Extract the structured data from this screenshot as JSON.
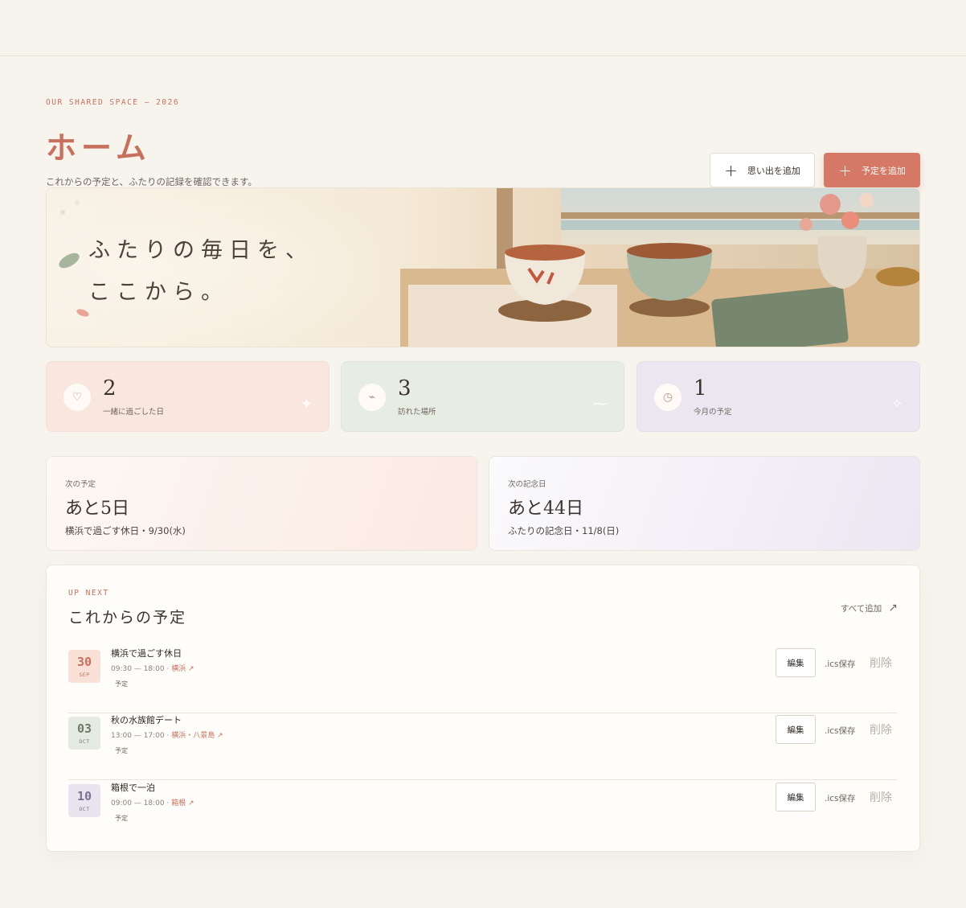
{
  "header": {
    "eyebrow": "OUR SHARED SPACE  —  2026",
    "title": "ホーム",
    "subtitle": "これからの予定と、ふたりの記録を確認できます。"
  },
  "actions": {
    "add_memory": "思い出を追加",
    "add_event": "予定を追加"
  },
  "hero": {
    "line1": "ふたりの毎日を、",
    "line2": "ここから。"
  },
  "stats": [
    {
      "value": "2",
      "label": "一緒に過ごした日",
      "icon": "heart-icon",
      "bg": "#f9e7df"
    },
    {
      "value": "3",
      "label": "訪れた場所",
      "icon": "route-icon",
      "bg": "#e8ede4"
    },
    {
      "value": "1",
      "label": "今月の予定",
      "icon": "clock-icon",
      "bg": "#ebe7f1"
    }
  ],
  "countdowns": [
    {
      "caption": "次の予定",
      "big": "あと5日",
      "info": "横浜で過ごす休日・9/30(水)"
    },
    {
      "caption": "次の記念日",
      "big": "あと44日",
      "info": "ふたりの記念日・11/8(日)"
    }
  ],
  "upcoming": {
    "eyebrow": "UP NEXT",
    "title": "これからの予定",
    "see_all": "すべて追加",
    "edit_label": "編集",
    "ics_label": ".ics保存",
    "delete_label": "削除",
    "events": [
      {
        "day": "30",
        "month": "SEP",
        "title": "横浜で過ごす休日",
        "time": "09:30 — 18:00 · ",
        "location": "横浜 ↗",
        "tag": "予定",
        "color": "#f9e1d8",
        "text_color": "#c8705c"
      },
      {
        "day": "03",
        "month": "OCT",
        "title": "秋の水族館デート",
        "time": "13:00 — 17:00 · ",
        "location": "横浜・八景島 ↗",
        "tag": "予定",
        "color": "#e5ebe1",
        "text_color": "#6d7a6a"
      },
      {
        "day": "10",
        "month": "OCT",
        "title": "箱根で一泊",
        "time": "09:00 — 18:00 · ",
        "location": "箱根 ↗",
        "tag": "予定",
        "color": "#e8e4f0",
        "text_color": "#7a7290"
      }
    ]
  }
}
